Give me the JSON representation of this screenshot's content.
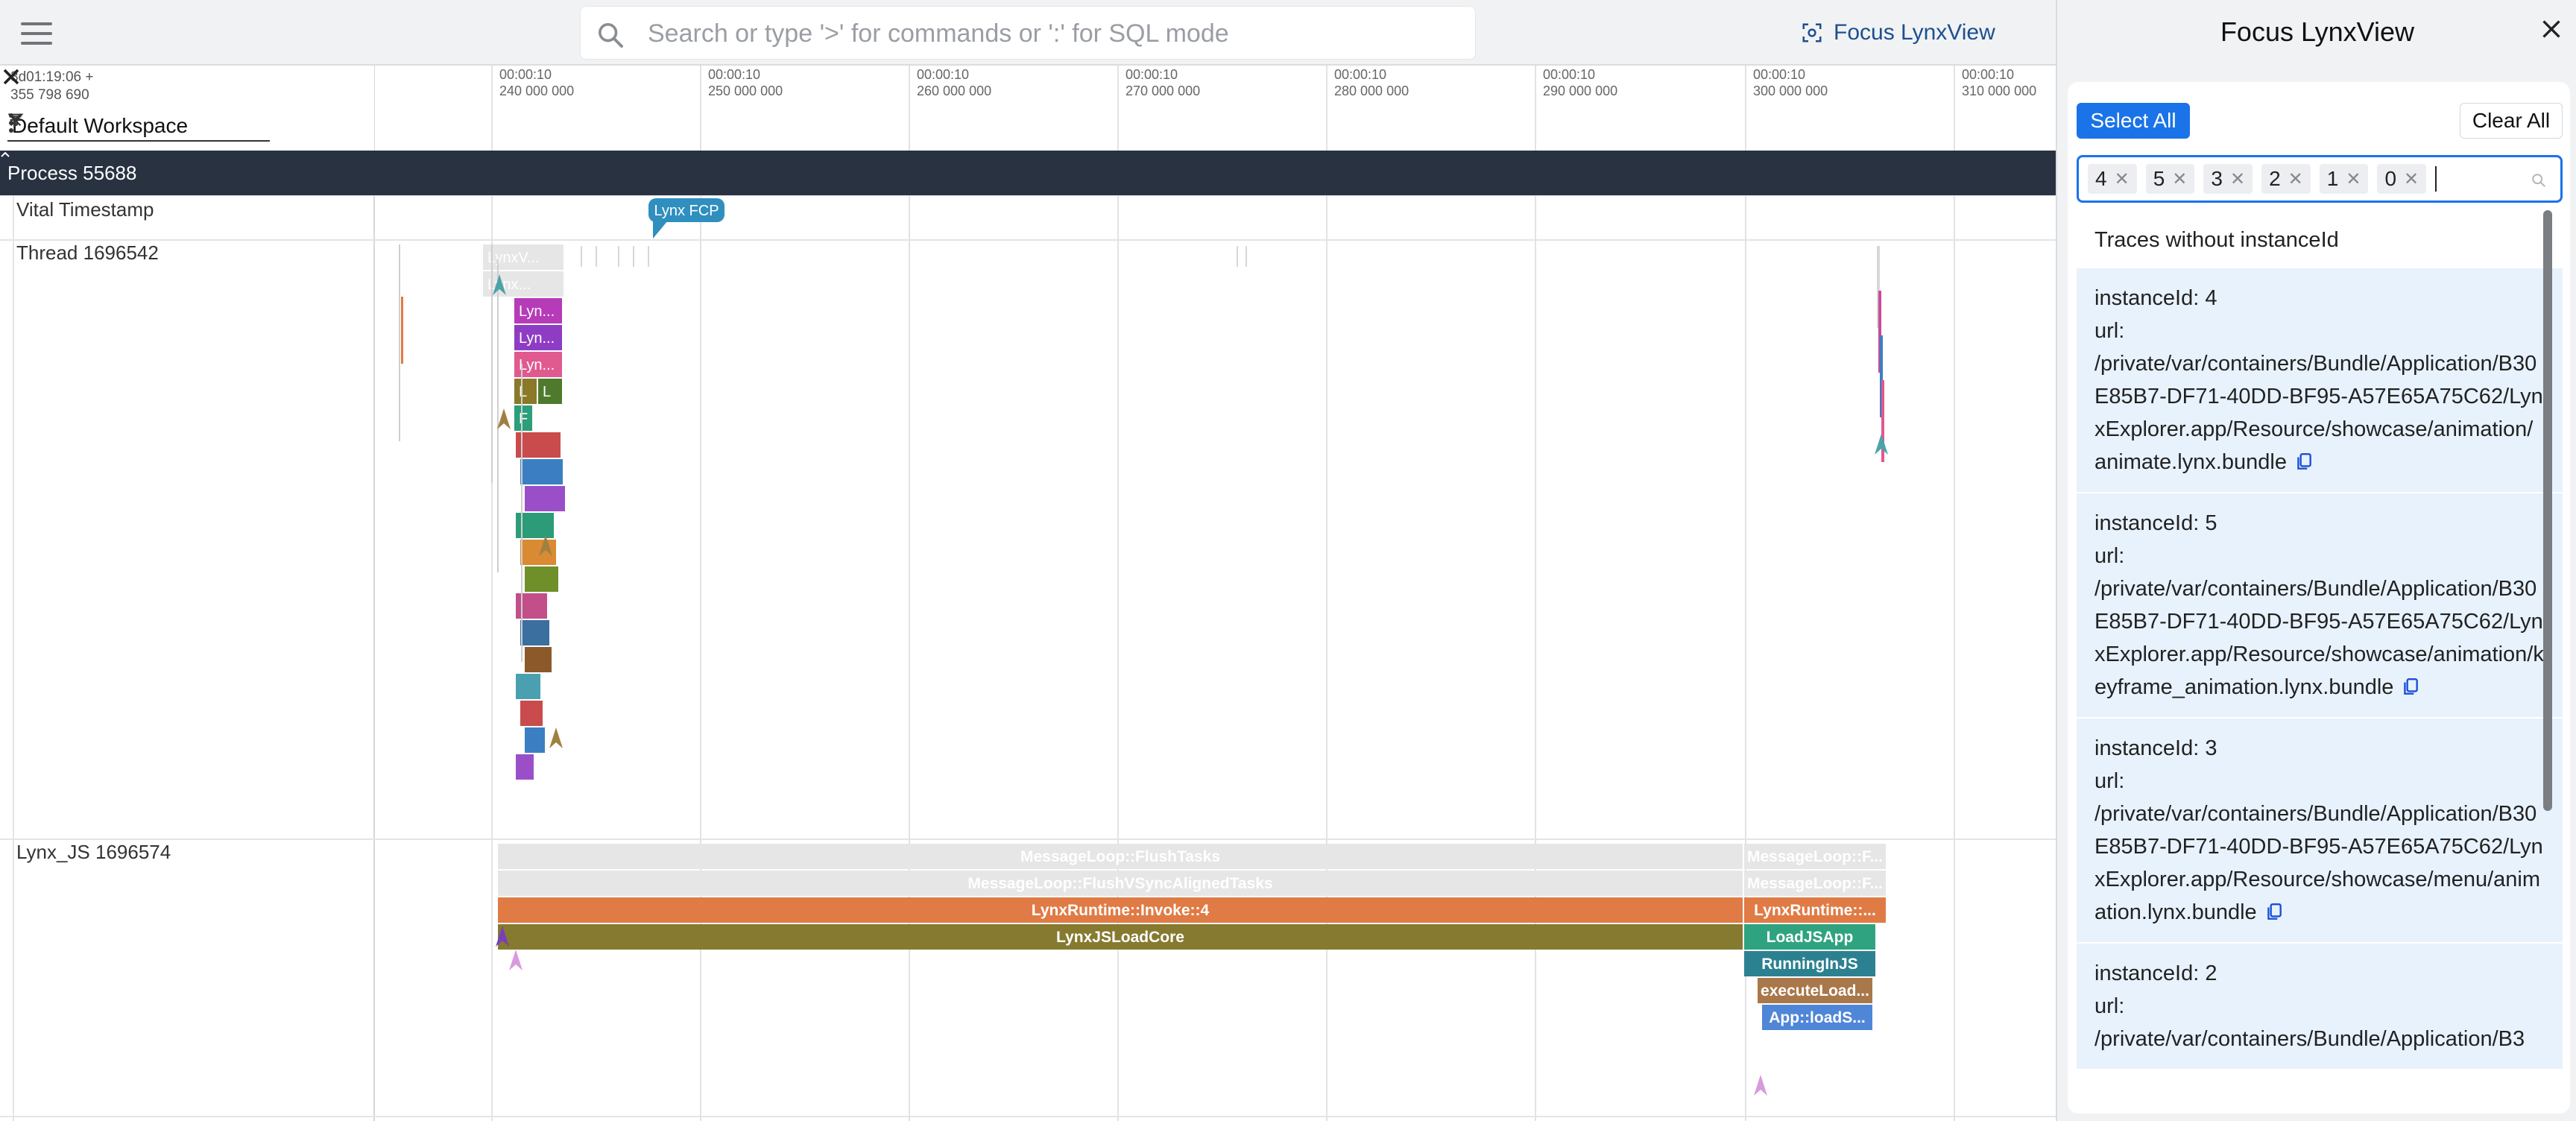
{
  "topbar": {
    "search_placeholder": "Search or type '>' for commands or ':' for SQL mode",
    "focus_button_label": "Focus LynxView"
  },
  "timeline": {
    "timestamp_line1": "3d01:19:06 +",
    "timestamp_line2": "355 798 690",
    "workspace": "Default Workspace",
    "ticks": [
      {
        "time": "00:00:10",
        "sub": "240 000 000"
      },
      {
        "time": "00:00:10",
        "sub": "250 000 000"
      },
      {
        "time": "00:00:10",
        "sub": "260 000 000"
      },
      {
        "time": "00:00:10",
        "sub": "270 000 000"
      },
      {
        "time": "00:00:10",
        "sub": "280 000 000"
      },
      {
        "time": "00:00:10",
        "sub": "290 000 000"
      },
      {
        "time": "00:00:10",
        "sub": "300 000 000"
      },
      {
        "time": "00:00:10",
        "sub": "310 000 000"
      }
    ],
    "process_label": "Process 55688",
    "tracks": {
      "vital": "Vital Timestamp",
      "thread": "Thread 1696542",
      "lynx_js": "Lynx_JS 1696574"
    },
    "fcp_marker": "Lynx FCP",
    "thread_slices": [
      "LynxV...",
      "Lynx...",
      "Lyn...",
      "Lyn...",
      "Lyn...",
      "L",
      "L",
      "F"
    ],
    "js_slices": {
      "flush_tasks": "MessageLoop::FlushTasks",
      "flush_vsync": "MessageLoop::FlushVSyncAlignedTasks",
      "runtime_invoke": "LynxRuntime::Invoke::4",
      "load_core": "LynxJSLoadCore",
      "flush_tasks_2": "MessageLoop::F...",
      "flush_vsync_2": "MessageLoop::F...",
      "runtime_invoke_2": "LynxRuntime::...",
      "load_js_app": "LoadJSApp",
      "running_in_js": "RunningInJS",
      "execute_load": "executeLoad...",
      "app_load": "App::loadS..."
    }
  },
  "panel": {
    "title": "Focus LynxView",
    "select_all": "Select All",
    "clear_all": "Clear All",
    "tags": [
      "4",
      "5",
      "3",
      "2",
      "1",
      "0"
    ],
    "no_instance_option": "Traces without instanceId",
    "options": [
      {
        "id_line": "instanceId: 4",
        "url_label": "url:",
        "url": "/private/var/containers/Bundle/Application/B30E85B7-DF71-40DD-BF95-A57E65A75C62/LynxExplorer.app/Resource/showcase/animation/animate.lynx.bundle"
      },
      {
        "id_line": "instanceId: 5",
        "url_label": "url:",
        "url": "/private/var/containers/Bundle/Application/B30E85B7-DF71-40DD-BF95-A57E65A75C62/LynxExplorer.app/Resource/showcase/animation/keyframe_animation.lynx.bundle"
      },
      {
        "id_line": "instanceId: 3",
        "url_label": "url:",
        "url": "/private/var/containers/Bundle/Application/B30E85B7-DF71-40DD-BF95-A57E65A75C62/LynxExplorer.app/Resource/showcase/menu/animation.lynx.bundle"
      },
      {
        "id_line": "instanceId: 2",
        "url_label": "url:",
        "url": "/private/var/containers/Bundle/Application/B3"
      }
    ]
  },
  "colors": {
    "accent": "#1a73e8",
    "process_bar": "#283241",
    "option_bg": "#e8f2fd",
    "orange_slice": "#e07b45",
    "olive_slice": "#857a2f",
    "green_slice": "#2fa37f"
  }
}
